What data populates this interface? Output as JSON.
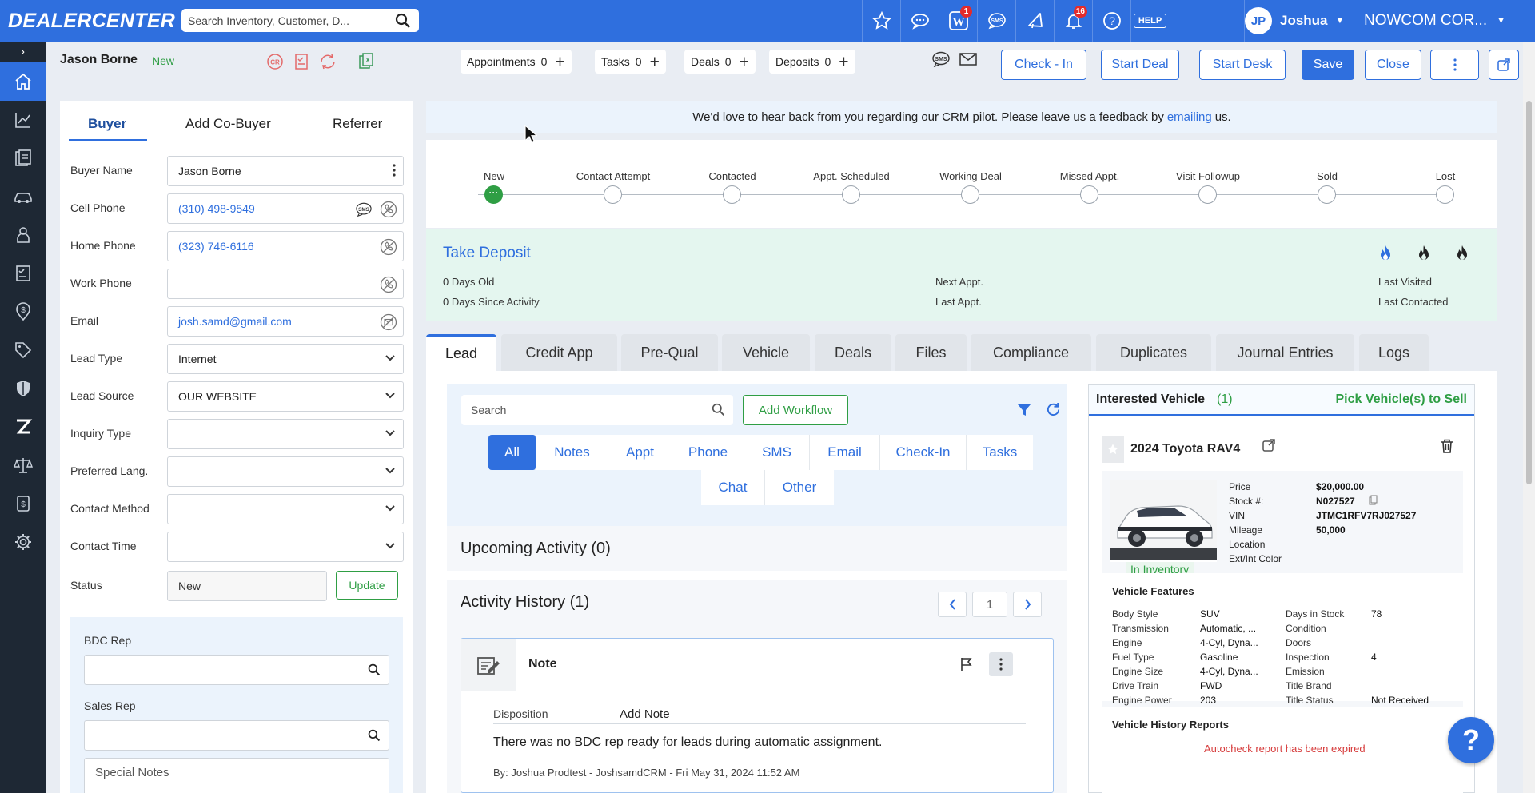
{
  "topbar": {
    "logo": "DEALERCENTER",
    "search_placeholder": "Search Inventory, Customer, D...",
    "badges": {
      "w": "1",
      "notifications": "16"
    },
    "help_label": "HELP",
    "user_initials": "JP",
    "user_name": "Joshua",
    "company": "NOWCOM COR..."
  },
  "subheader": {
    "customer_name": "Jason Borne",
    "customer_status": "New",
    "counters": [
      {
        "label": "Appointments",
        "count": "0"
      },
      {
        "label": "Tasks",
        "count": "0"
      },
      {
        "label": "Deals",
        "count": "0"
      },
      {
        "label": "Deposits",
        "count": "0"
      }
    ],
    "buttons": {
      "checkin": "Check - In",
      "start_deal": "Start Deal",
      "start_desk": "Start Desk",
      "save": "Save",
      "close": "Close"
    }
  },
  "left_panel": {
    "tabs": [
      "Buyer",
      "Add Co-Buyer",
      "Referrer"
    ],
    "fields": {
      "buyer_name": {
        "label": "Buyer Name",
        "value": "Jason Borne"
      },
      "cell_phone": {
        "label": "Cell Phone",
        "value": "(310) 498-9549"
      },
      "home_phone": {
        "label": "Home Phone",
        "value": "(323) 746-6116"
      },
      "work_phone": {
        "label": "Work Phone",
        "value": ""
      },
      "email": {
        "label": "Email",
        "value": "josh.samd@gmail.com"
      },
      "lead_type": {
        "label": "Lead Type",
        "value": "Internet"
      },
      "lead_source": {
        "label": "Lead Source",
        "value": "OUR WEBSITE"
      },
      "inquiry_type": {
        "label": "Inquiry Type",
        "value": ""
      },
      "preferred_lang": {
        "label": "Preferred Lang.",
        "value": ""
      },
      "contact_method": {
        "label": "Contact Method",
        "value": ""
      },
      "contact_time": {
        "label": "Contact Time",
        "value": ""
      },
      "status": {
        "label": "Status",
        "value": "New",
        "button": "Update"
      }
    },
    "bdc_rep_label": "BDC Rep",
    "sales_rep_label": "Sales Rep",
    "special_notes_placeholder": "Special Notes"
  },
  "banner": {
    "text_before": "We'd love to hear back from you regarding our CRM pilot. Please leave us a feedback by",
    "link": "emailing",
    "text_after": "us."
  },
  "stages": [
    "New",
    "Contact Attempt",
    "Contacted",
    "Appt. Scheduled",
    "Working Deal",
    "Missed Appt.",
    "Visit Followup",
    "Sold",
    "Lost"
  ],
  "deposit": {
    "title": "Take Deposit",
    "days_old": "0 Days Old",
    "days_since": "0 Days Since Activity",
    "next_appt": "Next Appt.",
    "last_appt": "Last Appt.",
    "last_visited": "Last Visited",
    "last_contacted": "Last Contacted"
  },
  "main_tabs": [
    "Lead",
    "Credit App",
    "Pre-Qual",
    "Vehicle",
    "Deals",
    "Files",
    "Compliance",
    "Duplicates",
    "Journal Entries",
    "Logs"
  ],
  "lead": {
    "search_placeholder": "Search",
    "add_workflow": "Add Workflow",
    "filters": [
      "All",
      "Notes",
      "Appt",
      "Phone",
      "SMS",
      "Email",
      "Check-In",
      "Tasks",
      "Chat",
      "Other"
    ],
    "upcoming_title": "Upcoming Activity (0)",
    "history_title": "Activity History (1)",
    "page": "1",
    "note": {
      "title": "Note",
      "disposition_label": "Disposition",
      "disposition_value": "Add Note",
      "body": "There was no BDC rep ready for leads during automatic assignment.",
      "by": "By: Joshua Prodtest - JoshsamdCRM - Fri May 31, 2024 11:52 AM"
    }
  },
  "vehicle_panel": {
    "title": "Interested Vehicle",
    "count": "(1)",
    "pick_link": "Pick Vehicle(s) to Sell",
    "vehicle_name": "2024 Toyota RAV4",
    "in_inventory": "In Inventory",
    "details": [
      {
        "label": "Price",
        "value": "$20,000.00"
      },
      {
        "label": "Stock #:",
        "value": "N027527"
      },
      {
        "label": "VIN",
        "value": "JTMC1RFV7RJ027527"
      },
      {
        "label": "Mileage",
        "value": "50,000"
      },
      {
        "label": "Location",
        "value": ""
      },
      {
        "label": "Ext/Int Color",
        "value": ""
      }
    ],
    "features_title": "Vehicle Features",
    "features_left": [
      {
        "label": "Body Style",
        "value": "SUV"
      },
      {
        "label": "Transmission",
        "value": "Automatic, ..."
      },
      {
        "label": "Engine",
        "value": "4-Cyl, Dyna..."
      },
      {
        "label": "Fuel Type",
        "value": "Gasoline"
      },
      {
        "label": "Engine Size",
        "value": "4-Cyl, Dyna..."
      },
      {
        "label": "Drive Train",
        "value": "FWD"
      },
      {
        "label": "Engine Power",
        "value": "203"
      }
    ],
    "features_right": [
      {
        "label": "Days in Stock",
        "value": "78"
      },
      {
        "label": "Condition",
        "value": ""
      },
      {
        "label": "Doors",
        "value": ""
      },
      {
        "label": "Inspection",
        "value": "4"
      },
      {
        "label": "Emission",
        "value": ""
      },
      {
        "label": "Title Brand",
        "value": ""
      },
      {
        "label": "Title Status",
        "value": "Not Received"
      }
    ],
    "history_title": "Vehicle History Reports",
    "autocheck_msg": "Autocheck report has been expired"
  },
  "help_fab": "?",
  "colors": {
    "primary": "#2f6fde",
    "sidebar": "#1e2834",
    "success": "#2f9e44",
    "danger": "#e42b2b"
  }
}
